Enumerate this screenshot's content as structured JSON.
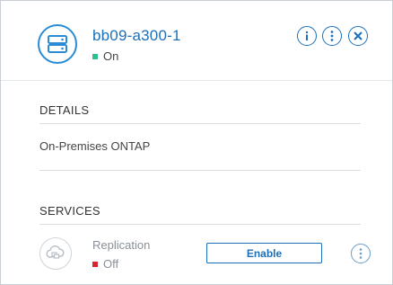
{
  "header": {
    "title": "bb09-a300-1",
    "status": "On"
  },
  "details": {
    "heading": "DETAILS",
    "type": "On-Premises ONTAP"
  },
  "services": {
    "heading": "SERVICES",
    "items": [
      {
        "name": "Replication",
        "status": "Off",
        "action": "Enable"
      }
    ]
  },
  "colors": {
    "accent": "#1d6fb8",
    "on": "#2fbf8a",
    "off": "#d9232e"
  },
  "icons": {
    "avatar": "storage-server-icon",
    "info": "info-icon",
    "more": "more-vertical-icon",
    "close": "close-icon",
    "service": "cloud-replication-icon"
  }
}
